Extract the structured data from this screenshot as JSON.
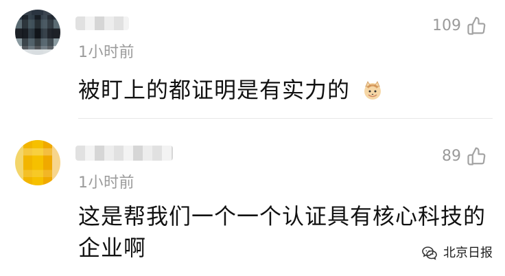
{
  "comments": [
    {
      "name": "",
      "time": "1小时前",
      "likes": "109",
      "text": "被盯上的都证明是有实力的",
      "emoji": "cat-emoji"
    },
    {
      "name": "",
      "time": "1小时前",
      "likes": "89",
      "text": "这是帮我们一个一个认证具有核心科技的企业啊"
    }
  ],
  "watermark": {
    "text": "北京日报"
  },
  "colors": {
    "background": "#ffffff",
    "meta_text": "#9a9a9a",
    "body_text": "#111111",
    "divider": "#e7e7e7"
  },
  "icons": {
    "like": "thumbs-up-icon",
    "watermark": "wechat-icon",
    "emoji": "cat-emoji"
  }
}
